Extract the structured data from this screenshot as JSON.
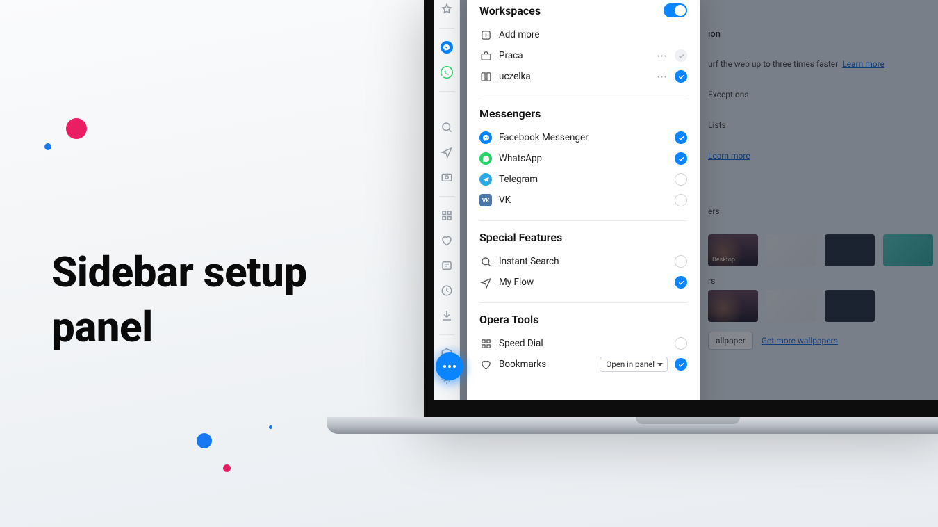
{
  "hero": {
    "title_line1": "Sidebar setup",
    "title_line2": "panel"
  },
  "panel": {
    "workspaces": {
      "title": "Workspaces",
      "add_more": "Add more",
      "items": [
        {
          "label": "Praca",
          "icon": "briefcase-icon",
          "checked": false
        },
        {
          "label": "uczelka",
          "icon": "book-icon",
          "checked": true
        }
      ]
    },
    "messengers": {
      "title": "Messengers",
      "items": [
        {
          "label": "Facebook Messenger",
          "badge": "fb",
          "checked": true
        },
        {
          "label": "WhatsApp",
          "badge": "wa",
          "checked": true
        },
        {
          "label": "Telegram",
          "badge": "tg",
          "checked": false
        },
        {
          "label": "VK",
          "badge": "vk",
          "checked": false
        }
      ]
    },
    "special": {
      "title": "Special Features",
      "items": [
        {
          "label": "Instant Search",
          "icon": "search-icon",
          "checked": false
        },
        {
          "label": "My Flow",
          "icon": "send-icon",
          "checked": true
        }
      ]
    },
    "tools": {
      "title": "Opera Tools",
      "items": [
        {
          "label": "Speed Dial",
          "icon": "grid-icon",
          "checked": false
        },
        {
          "label": "Bookmarks",
          "icon": "heart-icon",
          "checked": true,
          "select": "Open in panel"
        }
      ]
    }
  },
  "settings_bg": {
    "section_label": "ion",
    "adblock_text": "urf the web up to three times faster",
    "learn_more": "Learn more",
    "exceptions": "Exceptions",
    "lists": "Lists",
    "wallpapers_label_1": "ers",
    "wallpapers_label_2": "rs",
    "desktop_caption": "Desktop",
    "add_wallpaper": "allpaper",
    "get_more": "Get more wallpapers"
  }
}
